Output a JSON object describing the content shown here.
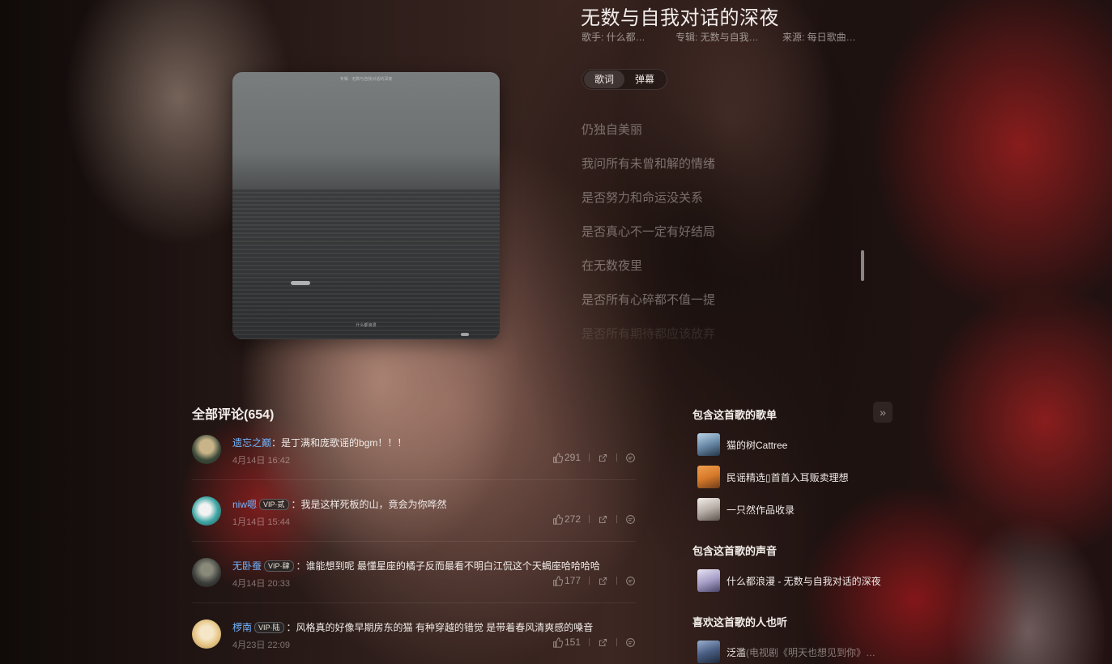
{
  "song": {
    "title": "无数与自我对话的深夜",
    "artist": "歌手: 什么都…",
    "album": "专辑: 无数与自我…",
    "source": "来源: 每日歌曲…"
  },
  "tabs": [
    {
      "label": "歌词",
      "active": true
    },
    {
      "label": "弹幕",
      "active": false
    }
  ],
  "lyrics": [
    "仍独自美丽",
    "我问所有未曾和解的情绪",
    "是否努力和命运没关系",
    "是否真心不一定有好结局",
    "在无数夜里",
    "是否所有心碎都不值一提",
    "是否所有期待都应该放弃"
  ],
  "comments": {
    "title": "全部评论(654)",
    "items": [
      {
        "user": "遗忘之巅",
        "vip": "",
        "text": "：是丁满和庞歌谣的bgm！！！",
        "time": "4月14日 16:42",
        "likes": "291"
      },
      {
        "user": "niw嗯",
        "vip": "VIP·贰",
        "text": "：我是这样死板的山，竟会为你哗然",
        "time": "1月14日 15:44",
        "likes": "272"
      },
      {
        "user": "无卧蚕",
        "vip": "VIP·肆",
        "text": "：谁能想到呢 最懂星座的橘子反而最看不明白江侃这个天蝎座哈哈哈哈",
        "time": "4月14日 20:33",
        "likes": "177"
      },
      {
        "user": "椤南",
        "vip": "VIP·陆",
        "text": "：风格真的好像早期房东的猫 有种穿越的错觉 是带着春风清爽感的嗓音",
        "time": "4月23日 22:09",
        "likes": "151"
      }
    ]
  },
  "sidebar": {
    "playlists_title": "包含这首歌的歌单",
    "playlists": [
      {
        "label": "猫的树Cattree"
      },
      {
        "label": "民谣精选▯首首入耳贩卖理想"
      },
      {
        "label": "一只然作品收录"
      }
    ],
    "voices_title": "包含这首歌的声音",
    "voices": [
      {
        "label": "什么都浪漫 - 无数与自我对话的深夜"
      }
    ],
    "also_title": "喜欢这首歌的人也听",
    "also": [
      {
        "label": "泛滥",
        "sub": " (电视剧《明天也想见到你》…"
      }
    ],
    "expand_icon": "»"
  },
  "cover": {
    "caption": "专辑 · 无数与自我对话的深夜",
    "signature": "什么都浪漫"
  }
}
